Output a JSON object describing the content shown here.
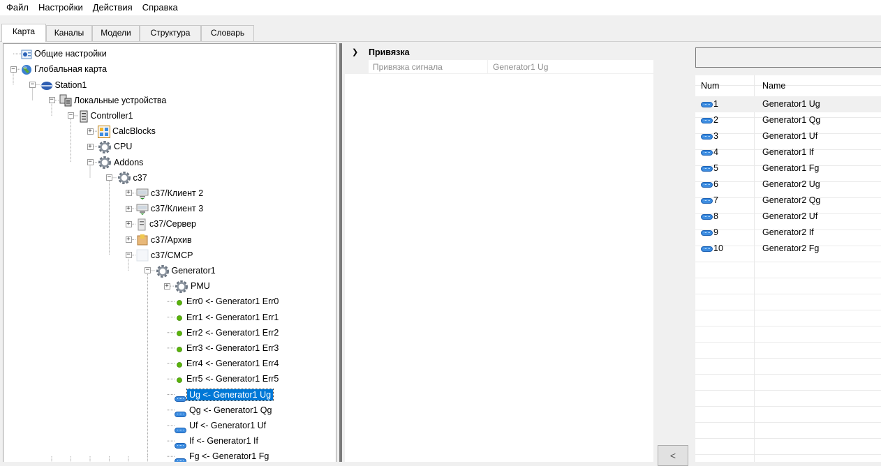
{
  "menu": [
    "Файл",
    "Настройки",
    "Действия",
    "Справка"
  ],
  "tabs": [
    "Карта",
    "Каналы",
    "Модели",
    "Структура",
    "Словарь"
  ],
  "active_tab": "Карта",
  "tree": [
    {
      "label": "Общие настройки",
      "icon": "settings-icon"
    },
    {
      "label": "Глобальная карта",
      "icon": "globe-icon"
    },
    {
      "label": "Station1",
      "icon": "station-icon"
    },
    {
      "label": "Локальные устройства",
      "icon": "devices-icon"
    },
    {
      "label": "Controller1",
      "icon": "controller-icon"
    },
    {
      "label": "CalcBlocks",
      "icon": "calcblocks-icon"
    },
    {
      "label": "CPU",
      "icon": "gear-icon"
    },
    {
      "label": "Addons",
      "icon": "gear-icon"
    },
    {
      "label": "c37",
      "icon": "gear-icon"
    },
    {
      "label": "c37/Клиент 2",
      "icon": "client-icon"
    },
    {
      "label": "c37/Клиент 3",
      "icon": "client-icon"
    },
    {
      "label": "c37/Сервер",
      "icon": "server-icon"
    },
    {
      "label": "c37/Архив",
      "icon": "archive-icon"
    },
    {
      "label": "c37/CMCP",
      "icon": "blank-icon"
    },
    {
      "label": "Generator1",
      "icon": "gear-icon"
    },
    {
      "label": "PMU",
      "icon": "gear-icon"
    },
    {
      "label": "Err0 <- Generator1 Err0",
      "icon": "green-dot-icon"
    },
    {
      "label": "Err1 <- Generator1 Err1",
      "icon": "green-dot-icon"
    },
    {
      "label": "Err2 <- Generator1 Err2",
      "icon": "green-dot-icon"
    },
    {
      "label": "Err3 <- Generator1 Err3",
      "icon": "green-dot-icon"
    },
    {
      "label": "Err4 <- Generator1 Err4",
      "icon": "green-dot-icon"
    },
    {
      "label": "Err5 <- Generator1 Err5",
      "icon": "green-dot-icon"
    },
    {
      "label": "Ug <- Generator1 Ug",
      "icon": "channel-icon",
      "selected": true
    },
    {
      "label": "Qg <- Generator1 Qg",
      "icon": "channel-icon"
    },
    {
      "label": "Uf <- Generator1 Uf",
      "icon": "channel-icon"
    },
    {
      "label": "If <- Generator1 If",
      "icon": "channel-icon"
    },
    {
      "label": "Fg <- Generator1 Fg",
      "icon": "channel-icon"
    }
  ],
  "properties": {
    "category": "Привязка",
    "rows": [
      {
        "name": "Привязка сигнала",
        "value": "Generator1 Ug"
      }
    ]
  },
  "assign_button": "<",
  "search": {
    "value": ""
  },
  "grid": {
    "columns": [
      "Num",
      "Name"
    ],
    "rows": [
      {
        "num": "1",
        "name": "Generator1 Ug"
      },
      {
        "num": "2",
        "name": "Generator1 Qg"
      },
      {
        "num": "3",
        "name": "Generator1 Uf"
      },
      {
        "num": "4",
        "name": "Generator1 If"
      },
      {
        "num": "5",
        "name": "Generator1 Fg"
      },
      {
        "num": "6",
        "name": "Generator2 Ug"
      },
      {
        "num": "7",
        "name": "Generator2 Qg"
      },
      {
        "num": "8",
        "name": "Generator2 Uf"
      },
      {
        "num": "9",
        "name": "Generator2 If"
      },
      {
        "num": "10",
        "name": "Generator2 Fg"
      }
    ]
  }
}
